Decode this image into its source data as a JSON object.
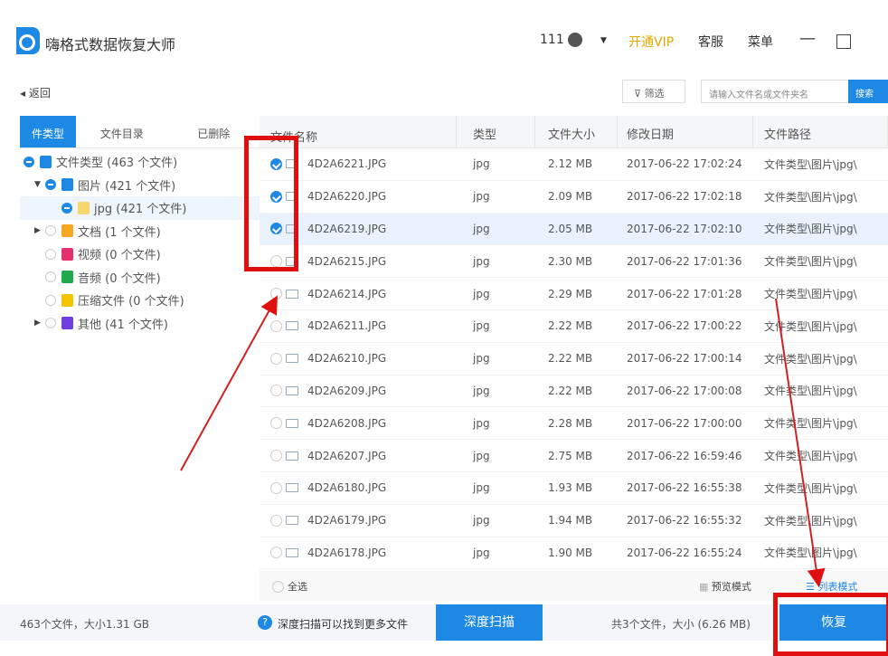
{
  "app": {
    "title": "嗨格式数据恢复大师",
    "user": "111",
    "vip": "开通VIP",
    "service": "客服",
    "menu": "菜单"
  },
  "toolbar": {
    "back": "返回",
    "filter": "筛选",
    "search_placeholder": "请输入文件名或文件夹名",
    "search": "搜索"
  },
  "tabs": [
    "件类型",
    "文件目录",
    "已删除"
  ],
  "tree": [
    {
      "label": "文件类型 (463 个文件)",
      "color": "#1e88e5"
    },
    {
      "label": "图片 (421 个文件)",
      "color": "#1e88e5"
    },
    {
      "label": "jpg (421 个文件)",
      "color": "#f5d76e"
    },
    {
      "label": "文档 (1 个文件)",
      "color": "#f5a623"
    },
    {
      "label": "视频 (0 个文件)",
      "color": "#e4306c"
    },
    {
      "label": "音频 (0 个文件)",
      "color": "#20a84c"
    },
    {
      "label": "压缩文件 (0 个文件)",
      "color": "#f5c400"
    },
    {
      "label": "其他 (41 个文件)",
      "color": "#6f3fe0"
    }
  ],
  "columns": [
    "文件名称",
    "类型",
    "文件大小",
    "修改日期",
    "文件路径"
  ],
  "rows": [
    {
      "name": "4D2A6221.JPG",
      "type": "jpg",
      "size": "2.12 MB",
      "date": "2017-06-22 17:02:24",
      "path": "文件类型\\图片\\jpg\\",
      "checked": true
    },
    {
      "name": "4D2A6220.JPG",
      "type": "jpg",
      "size": "2.09 MB",
      "date": "2017-06-22 17:02:18",
      "path": "文件类型\\图片\\jpg\\",
      "checked": true
    },
    {
      "name": "4D2A6219.JPG",
      "type": "jpg",
      "size": "2.05 MB",
      "date": "2017-06-22 17:02:10",
      "path": "文件类型\\图片\\jpg\\",
      "checked": true
    },
    {
      "name": "4D2A6215.JPG",
      "type": "jpg",
      "size": "2.30 MB",
      "date": "2017-06-22 17:01:36",
      "path": "文件类型\\图片\\jpg\\",
      "checked": false
    },
    {
      "name": "4D2A6214.JPG",
      "type": "jpg",
      "size": "2.29 MB",
      "date": "2017-06-22 17:01:28",
      "path": "文件类型\\图片\\jpg\\",
      "checked": false
    },
    {
      "name": "4D2A6211.JPG",
      "type": "jpg",
      "size": "2.22 MB",
      "date": "2017-06-22 17:00:22",
      "path": "文件类型\\图片\\jpg\\",
      "checked": false
    },
    {
      "name": "4D2A6210.JPG",
      "type": "jpg",
      "size": "2.22 MB",
      "date": "2017-06-22 17:00:14",
      "path": "文件类型\\图片\\jpg\\",
      "checked": false
    },
    {
      "name": "4D2A6209.JPG",
      "type": "jpg",
      "size": "2.22 MB",
      "date": "2017-06-22 17:00:08",
      "path": "文件类型\\图片\\jpg\\",
      "checked": false
    },
    {
      "name": "4D2A6208.JPG",
      "type": "jpg",
      "size": "2.28 MB",
      "date": "2017-06-22 17:00:00",
      "path": "文件类型\\图片\\jpg\\",
      "checked": false
    },
    {
      "name": "4D2A6207.JPG",
      "type": "jpg",
      "size": "2.75 MB",
      "date": "2017-06-22 16:59:46",
      "path": "文件类型\\图片\\jpg\\",
      "checked": false
    },
    {
      "name": "4D2A6180.JPG",
      "type": "jpg",
      "size": "1.93 MB",
      "date": "2017-06-22 16:55:38",
      "path": "文件类型\\图片\\jpg\\",
      "checked": false
    },
    {
      "name": "4D2A6179.JPG",
      "type": "jpg",
      "size": "1.94 MB",
      "date": "2017-06-22 16:55:32",
      "path": "文件类型\\图片\\jpg\\",
      "checked": false
    },
    {
      "name": "4D2A6178.JPG",
      "type": "jpg",
      "size": "1.90 MB",
      "date": "2017-06-22 16:55:24",
      "path": "文件类型\\图片\\jpg\\",
      "checked": false
    }
  ],
  "footer": {
    "select_all": "全选",
    "preview_mode": "预览模式",
    "list_mode": "列表模式"
  },
  "status": {
    "total": "463个文件，大小1.31 GB",
    "hint": "深度扫描可以找到更多文件",
    "deep_scan": "深度扫描",
    "selected": "共3个文件，大小 (6.26 MB)",
    "recover": "恢复"
  }
}
